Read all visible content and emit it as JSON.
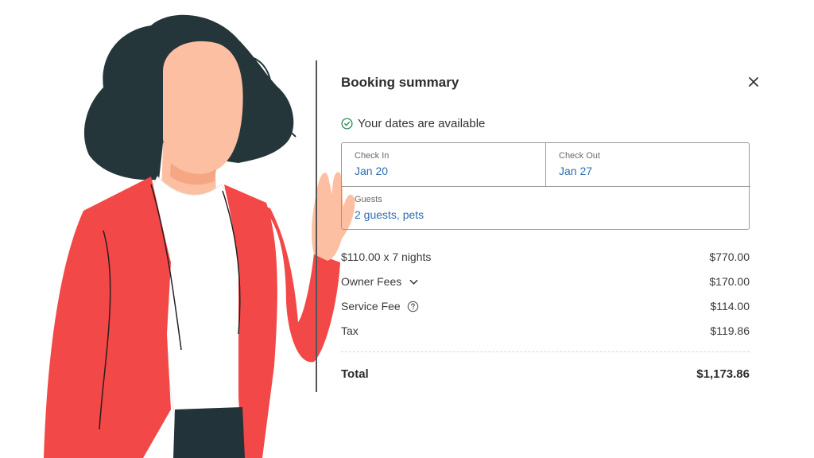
{
  "booking": {
    "title": "Booking summary",
    "availability": "Your dates are available",
    "check_in": {
      "label": "Check In",
      "value": "Jan 20"
    },
    "check_out": {
      "label": "Check Out",
      "value": "Jan 27"
    },
    "guests": {
      "label": "Guests",
      "value": "2 guests, pets"
    },
    "line_items": [
      {
        "label": "$110.00 x 7 nights",
        "amount": "$770.00"
      },
      {
        "label": "Owner Fees",
        "amount": "$170.00",
        "icon": "chevron-down-icon"
      },
      {
        "label": "Service Fee",
        "amount": "$114.00",
        "icon": "help-circle-icon"
      },
      {
        "label": "Tax",
        "amount": "$119.86"
      }
    ],
    "total": {
      "label": "Total",
      "amount": "$1,173.86"
    }
  },
  "icons": {
    "close": "close-icon",
    "availability": "check-circle-icon"
  },
  "colors": {
    "link_blue": "#2e6db4",
    "success_green": "#2f8a5b",
    "jacket_red": "#f24848",
    "hair_dark": "#24363a",
    "skin": "#fcbfa1"
  }
}
